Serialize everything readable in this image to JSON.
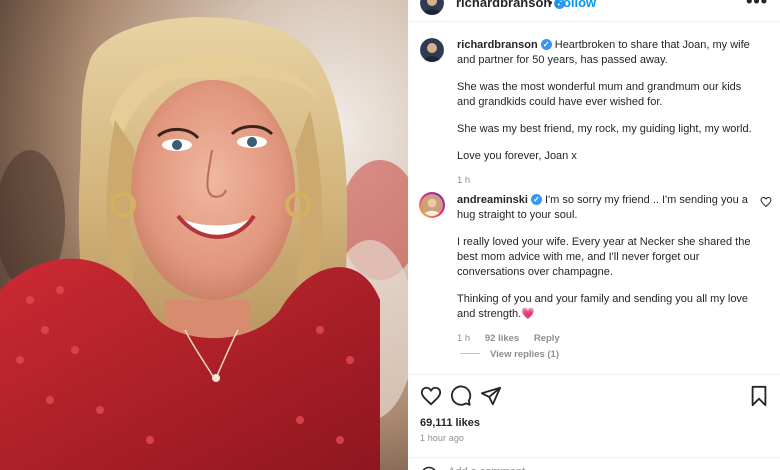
{
  "post": {
    "author": "richardbranson",
    "follow_label": "Follow",
    "separator": "•",
    "more_label": "•••",
    "caption": [
      "Heartbroken to share that Joan, my wife and partner for 50 years, has passed away.",
      "She was the most wonderful mum and grandmum our kids and grandkids could have ever wished for.",
      "She was my best friend, my rock, my guiding light, my world.",
      "Love you forever, Joan x"
    ],
    "caption_time": "1 h"
  },
  "comment": {
    "author": "andreaminski",
    "paragraphs": [
      "I'm so sorry my friend .. I'm sending you a hug straight to your soul.",
      "I really loved your wife. Every year at Necker she shared the best mom advice with me, and I'll never forget our conversations over champagne.",
      "Thinking of you and your family and sending you all my love and strength."
    ],
    "emoji": "💗",
    "time": "1 h",
    "likes": "92 likes",
    "reply_label": "Reply",
    "view_replies": "View replies (1)"
  },
  "actions": {
    "icons": [
      "heart-icon",
      "comment-icon",
      "share-icon",
      "bookmark-icon"
    ],
    "likes": "69,111 likes",
    "time_ago": "1 hour ago",
    "add_comment_placeholder": "Add a comment..."
  },
  "colors": {
    "link_blue": "#0095f6",
    "verified_blue": "#3897f0",
    "muted_gray": "#8e8e8e",
    "dress_red": "#b01e2a"
  }
}
